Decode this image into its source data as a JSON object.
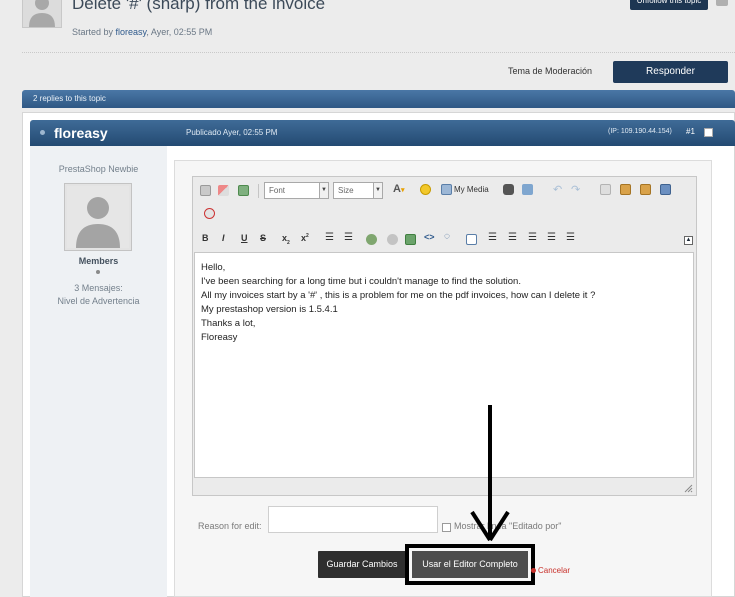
{
  "topic": {
    "title": "Delete '#' (sharp) from the invoice",
    "started_by_prefix": "Started by",
    "author": "floreasy",
    "date": ", Ayer, 02:55 PM",
    "unfollow_label": "Unfollow this topic"
  },
  "actions": {
    "moderation_label": "Tema de Moderación",
    "reply_label": "Responder"
  },
  "replies_bar": "2 replies to this topic",
  "post": {
    "author": "floreasy",
    "published": "Publicado Ayer, 02:55 PM",
    "ip": "(IP: 109.190.44.154)",
    "number": "#1"
  },
  "author_info": {
    "rank": "PrestaShop Newbie",
    "group": "Members",
    "messages": "3 Mensajes:",
    "warning": "Nivel de Advertencia"
  },
  "editor": {
    "font_select": "Font",
    "size_select": "Size",
    "my_media": "My Media",
    "bold": "B",
    "italic": "I",
    "underline": "U",
    "strike": "S",
    "subscript": "x",
    "superscript": "x",
    "body_lines": [
      "Hello,",
      "I've been searching for a long time but i couldn't manage to find the solution.",
      "",
      "All my invoices start by a '#' , this is a problem for me on the pdf invoices, how can I delete it ?",
      "",
      "My prestashop version is 1.5.4.1",
      "",
      "Thanks a lot,",
      "",
      "Floreasy"
    ]
  },
  "edit_form": {
    "reason_label": "Reason for edit:",
    "reason_value": "",
    "mostrar_label": "Mostrar línea \"Editado por\"",
    "save_label": "Guardar Cambios",
    "full_editor_label": "Usar el Editor Completo",
    "cancel_label": "Cancelar"
  },
  "icons": {
    "toolbar_row1": [
      "paste-icon",
      "eraser-icon",
      "source-icon",
      "text-color-icon",
      "smiley-icon",
      "media-icon",
      "binoculars-icon",
      "replace-icon",
      "undo-icon",
      "redo-icon",
      "copy-icon",
      "paste-text-icon",
      "paste-word-icon",
      "paste-special-icon"
    ],
    "toolbar_row2": [
      "remove-format-icon"
    ],
    "toolbar_row3": [
      "bullet-list-icon",
      "numbered-list-icon",
      "link-icon",
      "unlink-icon",
      "image-icon",
      "code-icon",
      "quote-icon",
      "spoiler-icon",
      "indent-icon",
      "align-left-icon",
      "align-center-icon",
      "align-right-icon"
    ]
  },
  "colors": {
    "header_blue": "#234a72",
    "button_dark": "#2f2f2f",
    "cancel_red": "#c8302a"
  }
}
